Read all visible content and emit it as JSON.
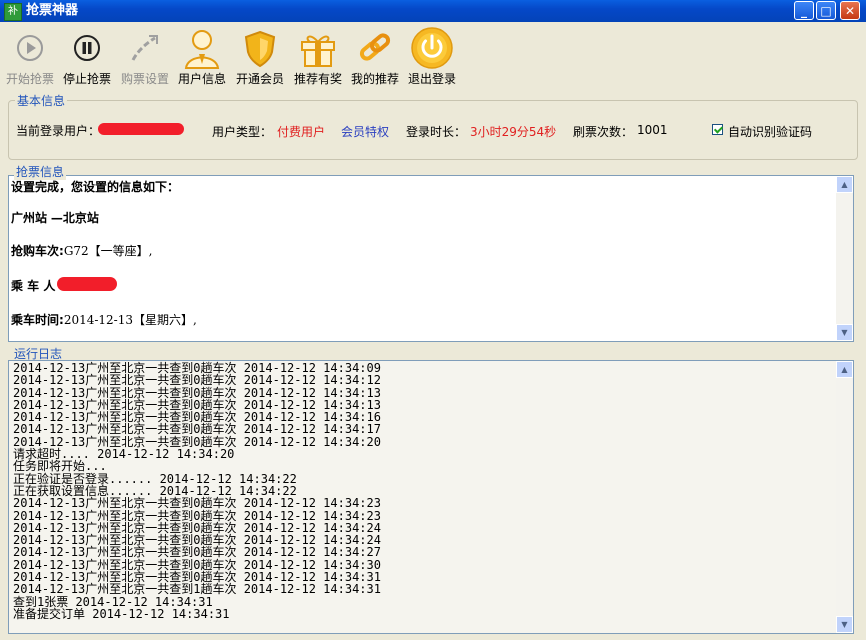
{
  "window": {
    "title": "抢票神器",
    "icon_text": "补"
  },
  "toolbar": {
    "start": "开始抢票",
    "stop": "停止抢票",
    "settings": "购票设置",
    "user_info": "用户信息",
    "member": "开通会员",
    "recommend": "推荐有奖",
    "my_recommend": "我的推荐",
    "logout": "退出登录"
  },
  "basic_info": {
    "legend": "基本信息",
    "current_user_label": "当前登录用户：",
    "user_type_label": "用户类型：",
    "user_type_value": "付费用户",
    "member_privilege": "会员特权",
    "login_duration_label": "登录时长：",
    "login_duration_value": "3小时29分54秒",
    "refresh_count_label": "刷票次数：",
    "refresh_count_value": "1001",
    "auto_captcha_label": "自动识别验证码",
    "auto_captcha_checked": true
  },
  "ticket_info": {
    "legend": "抢票信息",
    "header": "设置完成，您设置的信息如下：",
    "from_station": "广州站",
    "to_station": "—北京站",
    "train_label": "抢购车次:",
    "train_value": "G72【一等座】,",
    "passenger_label": "乘 车 人",
    "date_label": "乘车时间:",
    "date_value": "2014-12-13【星期六】,"
  },
  "log": {
    "legend": "运行日志",
    "lines": [
      "2014-12-13广州至北京一共查到0趟车次 2014-12-12 14:34:09",
      "2014-12-13广州至北京一共查到0趟车次 2014-12-12 14:34:12",
      "2014-12-13广州至北京一共查到0趟车次 2014-12-12 14:34:13",
      "2014-12-13广州至北京一共查到0趟车次 2014-12-12 14:34:13",
      "2014-12-13广州至北京一共查到0趟车次 2014-12-12 14:34:16",
      "2014-12-13广州至北京一共查到0趟车次 2014-12-12 14:34:17",
      "2014-12-13广州至北京一共查到0趟车次 2014-12-12 14:34:20",
      "请求超时.... 2014-12-12 14:34:20",
      "任务即将开始...",
      "正在验证是否登录...... 2014-12-12 14:34:22",
      "正在获取设置信息...... 2014-12-12 14:34:22",
      "2014-12-13广州至北京一共查到0趟车次 2014-12-12 14:34:23",
      "2014-12-13广州至北京一共查到0趟车次 2014-12-12 14:34:23",
      "2014-12-13广州至北京一共查到0趟车次 2014-12-12 14:34:24",
      "2014-12-13广州至北京一共查到0趟车次 2014-12-12 14:34:24",
      "2014-12-13广州至北京一共查到0趟车次 2014-12-12 14:34:27",
      "2014-12-13广州至北京一共查到0趟车次 2014-12-12 14:34:30",
      "2014-12-13广州至北京一共查到0趟车次 2014-12-12 14:34:31",
      "2014-12-13广州至北京一共查到1趟车次 2014-12-12 14:34:31",
      "查到1张票 2014-12-12 14:34:31",
      "准备提交订单 2014-12-12 14:34:31"
    ]
  },
  "colors": {
    "titlebar": "#0548C8",
    "accent_blue": "#2255BB",
    "paid_red": "#E02020",
    "icon_gold": "#F2A91A"
  }
}
